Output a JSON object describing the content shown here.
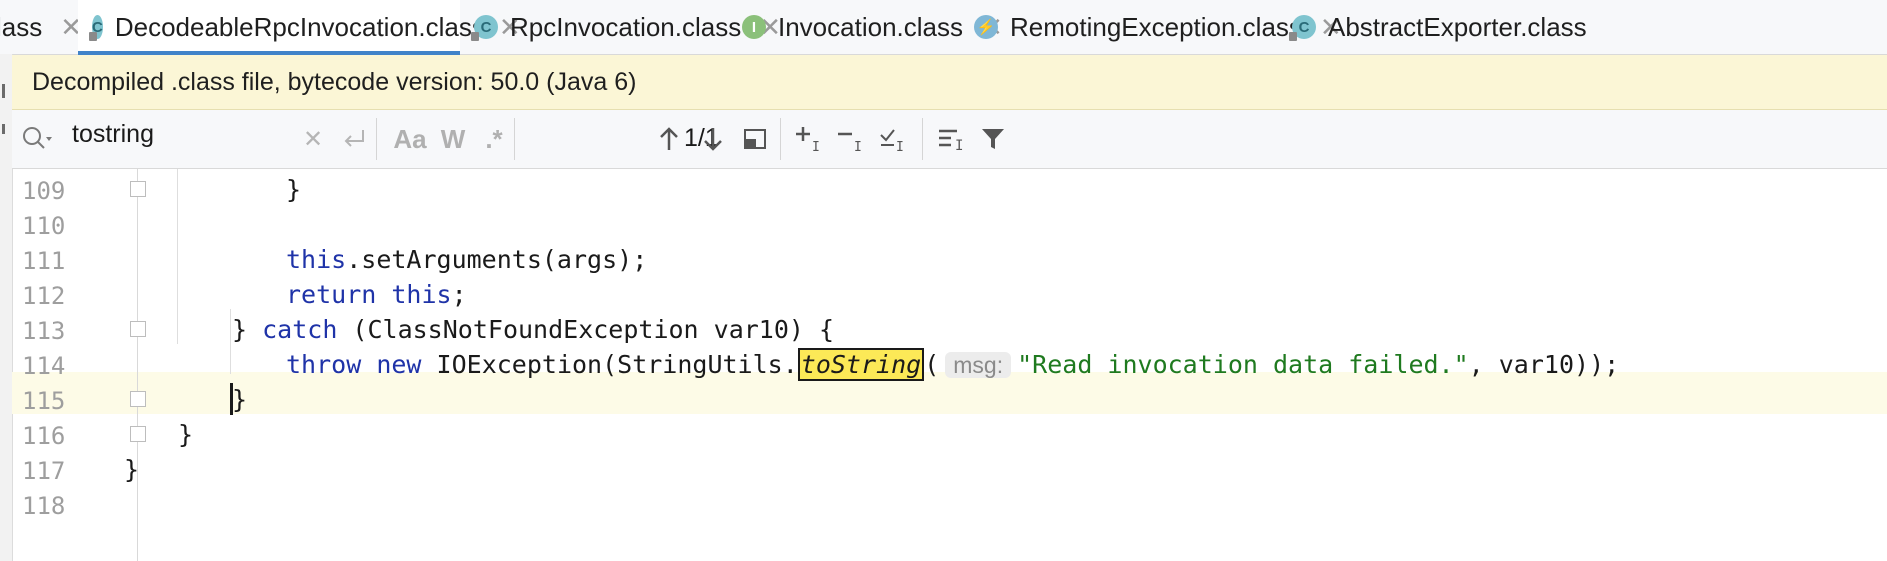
{
  "tabs": [
    {
      "label": "lass",
      "icon": "class-icon",
      "active": false
    },
    {
      "label": "DecodeableRpcInvocation.class",
      "icon": "class-icon",
      "active": true
    },
    {
      "label": "RpcInvocation.class",
      "icon": "class-icon",
      "active": false
    },
    {
      "label": "Invocation.class",
      "icon": "interface-icon",
      "active": false
    },
    {
      "label": "RemotingException.class",
      "icon": "exception-icon",
      "active": false
    },
    {
      "label": "AbstractExporter.class",
      "icon": "class-icon",
      "active": false
    }
  ],
  "banner": {
    "text": "Decompiled .class file, bytecode version: 50.0 (Java 6)"
  },
  "search": {
    "query": "tostring",
    "match_case": "Aa",
    "words": "W",
    "regex": ".*",
    "counter": "1/1"
  },
  "editor": {
    "current_line": 115,
    "lines": [
      {
        "num": "109",
        "text": "}"
      },
      {
        "num": "110",
        "text": ""
      },
      {
        "num": "111",
        "kw": "this",
        "text": ".setArguments(args);"
      },
      {
        "num": "112",
        "kw": "return",
        "kw2": "this",
        "text": ";"
      },
      {
        "num": "113",
        "pre": "} ",
        "kw": "catch",
        "text": " (ClassNotFoundException var10) {"
      },
      {
        "num": "114",
        "kw": "throw",
        "kw2": "new",
        "pre": " IOException(StringUtils.",
        "match": "toString",
        "paren": "(",
        "hint": "msg:",
        "str": "\"Read invocation data failed.\"",
        "post": ", var10));"
      },
      {
        "num": "115",
        "text": "}"
      },
      {
        "num": "116",
        "text": "}"
      },
      {
        "num": "117",
        "text": "}"
      },
      {
        "num": "118",
        "text": ""
      }
    ]
  },
  "colors": {
    "keyword": "#1f33a8",
    "string": "#1f7a1f",
    "match_highlight": "#fce957",
    "banner": "#fbf6d6",
    "tab_underline": "#4083c9"
  }
}
